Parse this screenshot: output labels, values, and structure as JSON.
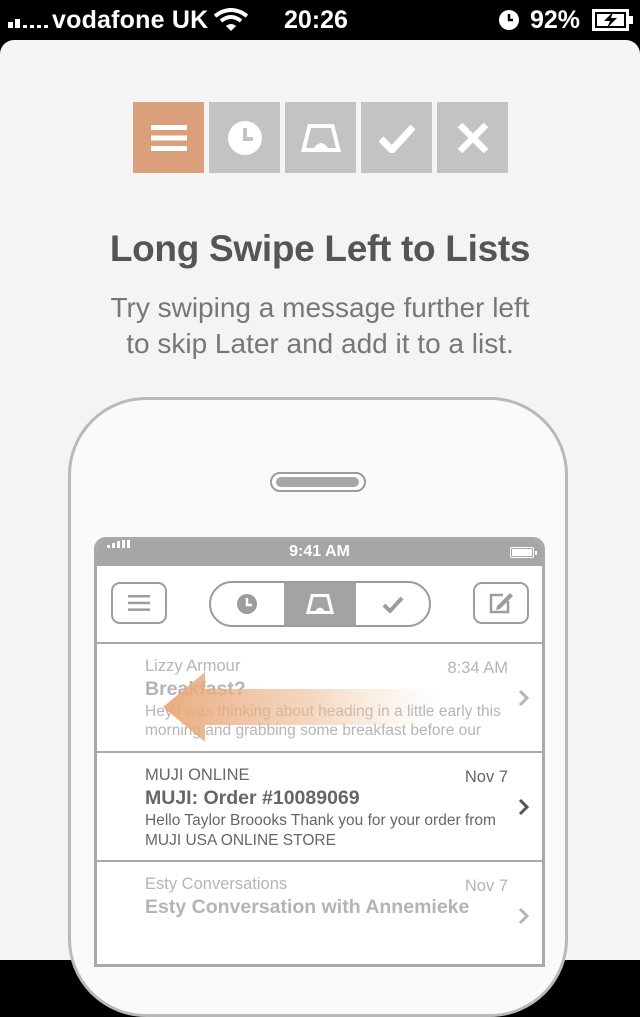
{
  "status_bar": {
    "carrier": "vodafone UK",
    "time": "20:26",
    "battery_percent": "92%",
    "icons": [
      "signal-icon",
      "wifi-icon",
      "alarm-clock-icon",
      "battery-charging-icon"
    ]
  },
  "action_bar": {
    "items": [
      {
        "name": "list",
        "icon": "list-icon",
        "active": true
      },
      {
        "name": "later",
        "icon": "clock-icon",
        "active": false
      },
      {
        "name": "inbox",
        "icon": "inbox-tray-icon",
        "active": false
      },
      {
        "name": "done",
        "icon": "checkmark-icon",
        "active": false
      },
      {
        "name": "delete",
        "icon": "close-icon",
        "active": false
      }
    ],
    "active_color": "#d9a07b",
    "inactive_color": "#c2c4c3"
  },
  "tutorial": {
    "title": "Long Swipe Left to Lists",
    "subtitle_line1": "Try swiping a message further left",
    "subtitle_line2": "to skip Later and add it to a list."
  },
  "illustration": {
    "status_time": "9:41 AM",
    "toolbar": {
      "left_icon": "menu-icon",
      "segments": [
        "clock-icon",
        "inbox-tray-icon",
        "checkmark-icon"
      ],
      "selected_segment": "inbox-tray-icon",
      "right_icon": "compose-icon"
    },
    "messages": [
      {
        "from": "Lizzy Armour",
        "date": "8:34 AM",
        "subject": "Breakfast?",
        "preview": "Hey I was thinking about heading in a little early this morning and grabbing some breakfast before our"
      },
      {
        "from": "MUJI ONLINE",
        "date": "Nov 7",
        "subject": "MUJI: Order #10089069",
        "preview": "Hello Taylor Broooks Thank you for your order from MUJI USA ONLINE STORE"
      },
      {
        "from": "Esty Conversations",
        "date": "Nov 7",
        "subject": "Esty Conversation with Annemieke",
        "preview": ""
      }
    ],
    "swipe_arrow_color": "#e8a878"
  }
}
